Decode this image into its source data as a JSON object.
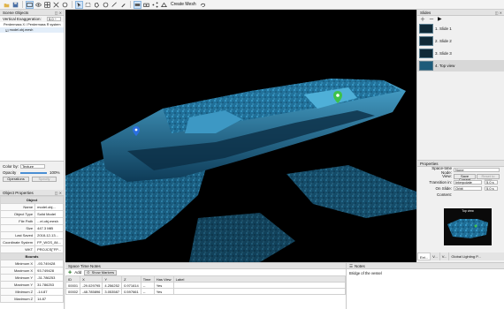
{
  "toolbar": {
    "create_mesh_label": "Create Mesh"
  },
  "scene_objects": {
    "title": "Scene Objects",
    "vertical_exaggeration_label": "Vertical Exaggeration:",
    "vertical_exaggeration_value": "5.0 ÷",
    "tree_root": "Perdermass X / Perdermass R system",
    "tree_child": "model.obj.mesh"
  },
  "color_by": {
    "label": "Color by:",
    "value": "Texture"
  },
  "opacity": {
    "label": "Opacity",
    "value": "100%",
    "level_pct": 100
  },
  "operations": {
    "operations_label": "Operations",
    "specify_label": "Specify"
  },
  "object_properties": {
    "title": "Object Properties",
    "header": "Object",
    "rows": [
      {
        "k": "Name",
        "v": "model.obj..."
      },
      {
        "k": "Object Type",
        "v": "Solid Model"
      },
      {
        "k": "File Path",
        "v": "...el.obj.mesh"
      },
      {
        "k": "Size",
        "v": "447.3 MiB"
      },
      {
        "k": "Last Saved",
        "v": "2018-12-13..."
      },
      {
        "k": "Coordinate System",
        "v": "FP_WGS_84..."
      },
      {
        "k": "WKT",
        "v": "PROJCS[\"FP..."
      }
    ],
    "bounds_header": "Bounds",
    "bounds": [
      {
        "k": "Minimum X",
        "v": "-93.749428"
      },
      {
        "k": "Maximum X",
        "v": "93.749428"
      },
      {
        "k": "Minimum Y",
        "v": "-31.786253"
      },
      {
        "k": "Maximum Y",
        "v": "31.786253"
      },
      {
        "k": "Minimum Z",
        "v": "-14.87"
      },
      {
        "k": "Maximum Z",
        "v": "14.87"
      }
    ]
  },
  "slides": {
    "title": "Slides",
    "items": [
      {
        "label": "1. Slide 1"
      },
      {
        "label": "2. Slide 2"
      },
      {
        "label": "3. Slide 3"
      },
      {
        "label": "4. Top view"
      }
    ]
  },
  "properties": {
    "title": "Properties",
    "space_time_node_label": "Space-time Node:",
    "space_time_node_value": "None",
    "view_label": "View:",
    "save_current_label": "Save Current",
    "reset_to_slide_label": "Reset to Slide",
    "transition_in_label": "Transition in:",
    "transition_in_value": "Interpolate",
    "transition_in_seconds": "5.0 s",
    "on_slide_label": "On Slide:",
    "on_slide_value": "Orbit",
    "on_slide_seconds": "5.0 s",
    "content_label": "Content:",
    "preview_caption": "Top view"
  },
  "bottom_tabs": [
    "Ext...",
    "V...",
    "V...",
    "Global Lighting P..."
  ],
  "space_time_notes": {
    "title": "Space Time Notes",
    "add_label": "Add",
    "show_markers_label": "Show Markers",
    "columns": [
      "ID",
      "X",
      "Y",
      "Z",
      "Time",
      "Has View",
      "Label"
    ],
    "rows": [
      [
        "00001",
        "-29.029795",
        "4.256252",
        "0.971614",
        "--",
        "Yes",
        ""
      ],
      [
        "00002",
        "-48.785896",
        "3.053587",
        "0.597661",
        "--",
        "Yes",
        ""
      ]
    ]
  },
  "notes": {
    "title": "Notes",
    "text": "Bridge of the vessel"
  },
  "colors": {
    "viewport_bg": "#000000",
    "mesh": "#2f86b0",
    "marker_green": "#3ec24a",
    "marker_blue": "#2b6fe0"
  }
}
